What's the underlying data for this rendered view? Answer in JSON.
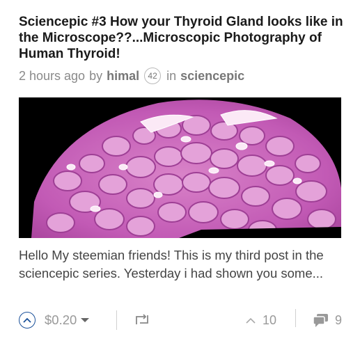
{
  "post": {
    "title": "Sciencepic #3 How your Thyroid Gland looks like in the Microscope??...Microscopic Photography of Human Thyroid!",
    "time_ago": "2 hours ago",
    "by_label": "by",
    "author": "himal",
    "reputation": "42",
    "in_label": "in",
    "category": "sciencepic",
    "excerpt": "Hello My steemian friends! This is my third post in the sciencepic series. Yesterday i had shown you some...",
    "thumbnail_description": "microscope-slide-thyroid-tissue"
  },
  "footer": {
    "payout": "$0.20",
    "votes": "10",
    "replies": "9"
  },
  "icons": {
    "upvote": "chevron-up-circle-icon",
    "payout_dropdown": "caret-down-icon",
    "resteem": "resteem-icon",
    "votes": "chevron-up-icon",
    "replies": "chat-bubbles-icon"
  },
  "colors": {
    "accent": "#1a5099",
    "title": "#1a1a1a",
    "muted": "#999999",
    "tissue": "#c25ab5"
  }
}
